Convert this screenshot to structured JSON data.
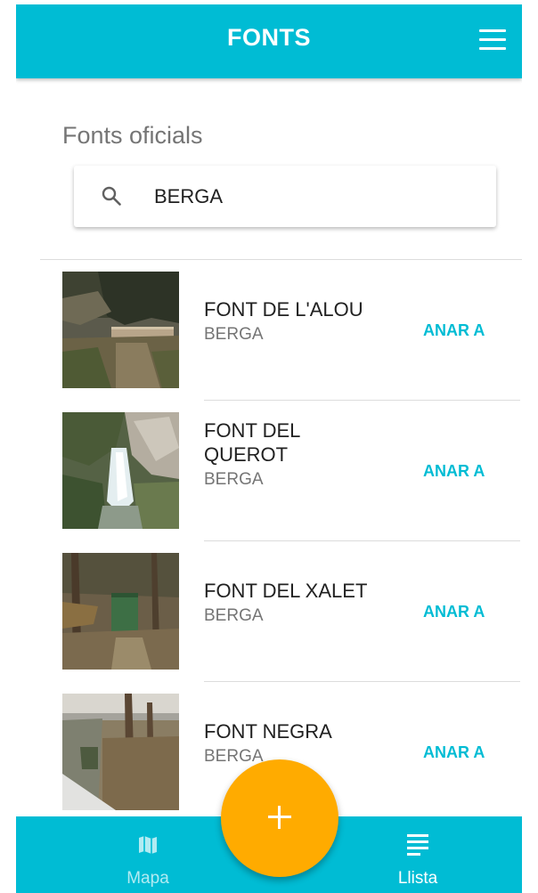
{
  "app_bar": {
    "title": "FONTS",
    "menu_icon": "menu-icon"
  },
  "section": {
    "title": "Fonts oficials"
  },
  "search": {
    "value": "BERGA",
    "icon": "search-icon"
  },
  "items": [
    {
      "name": "FONT DE L'ALOU",
      "town": "BERGA",
      "action": "ANAR A"
    },
    {
      "name": "FONT DEL QUEROT",
      "town": "BERGA",
      "action": "ANAR A"
    },
    {
      "name": "FONT DEL XALET",
      "town": "BERGA",
      "action": "ANAR A"
    },
    {
      "name": "FONT NEGRA",
      "town": "BERGA",
      "action": "ANAR A"
    }
  ],
  "bottom_nav": {
    "map": {
      "label": "Mapa",
      "icon": "map-icon",
      "color": "#b2ebf2"
    },
    "list": {
      "label": "Llista",
      "icon": "list-icon",
      "color": "#ffffff"
    }
  },
  "fab": {
    "icon": "plus-icon",
    "color": "#ffab00"
  },
  "colors": {
    "primary": "#00bcd4",
    "accent": "#ffab00"
  }
}
